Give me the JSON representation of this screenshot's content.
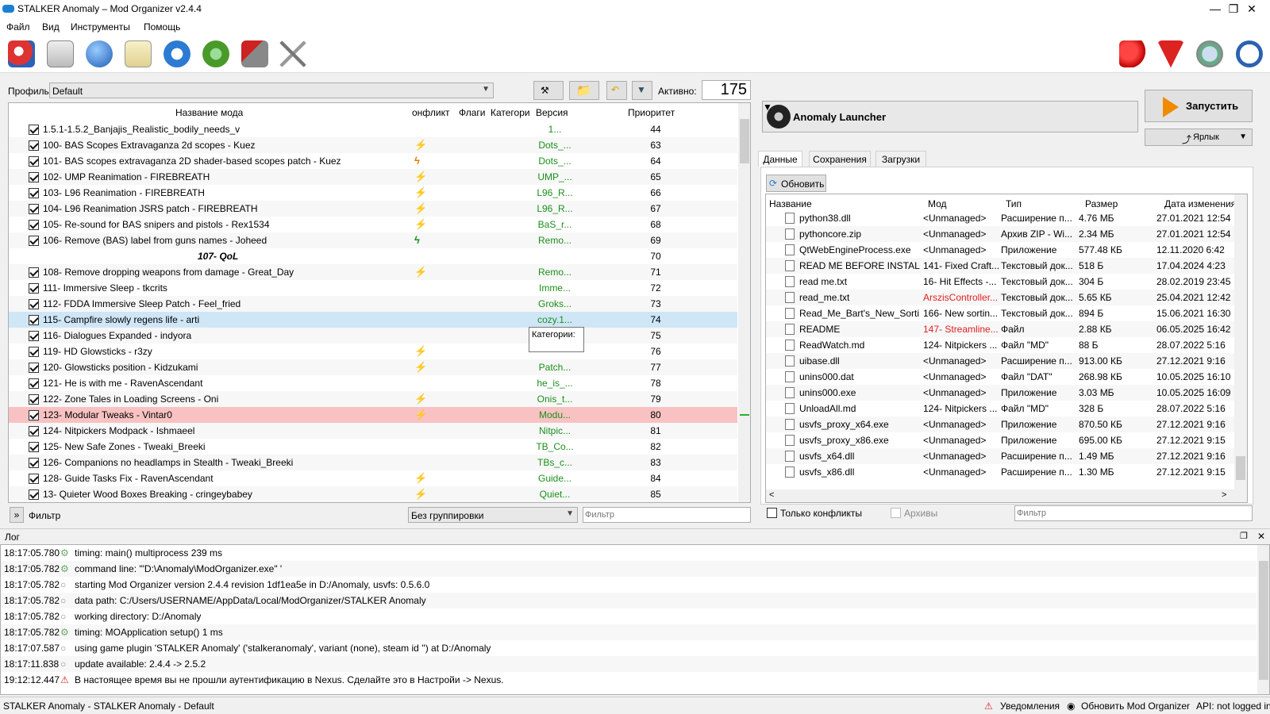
{
  "window": {
    "title": "STALKER Anomaly – Mod Organizer v2.4.4"
  },
  "menu": [
    "Файл",
    "Вид",
    "Инструменты",
    "Помощь"
  ],
  "profile": {
    "label": "Профиль",
    "value": "Default",
    "active_label": "Активно:",
    "active_count": "175"
  },
  "modlist": {
    "headers": {
      "name": "Название мода",
      "conflict": "онфликт",
      "flags": "Флаги",
      "category": "Категори",
      "version": "Версия",
      "priority": "Приоритет"
    },
    "tooltip": "Категории:",
    "rows": [
      {
        "name": "1.5.1-1.5.2_Banjajis_Realistic_bodily_needs_v",
        "conflict": "",
        "version": "1...",
        "priority": "44"
      },
      {
        "name": "100- BAS Scopes Extravaganza 2d scopes - Kuez",
        "conflict": "⚡",
        "version": "Dots_...",
        "priority": "63"
      },
      {
        "name": "101- BAS scopes extravaganza 2D shader-based scopes patch - Kuez",
        "conflict": "ϟ",
        "version": "Dots_...",
        "priority": "64"
      },
      {
        "name": "102- UMP Reanimation - FIREBREATH",
        "conflict": "⚡",
        "version": "UMP_...",
        "priority": "65"
      },
      {
        "name": "103- L96 Reanimation - FIREBREATH",
        "conflict": "⚡",
        "version": "L96_R...",
        "priority": "66"
      },
      {
        "name": "104- L96 Reanimation JSRS patch - FIREBREATH",
        "conflict": "⚡",
        "version": "L96_R...",
        "priority": "67"
      },
      {
        "name": "105- Re-sound for BAS snipers and pistols - Rex1534",
        "conflict": "⚡",
        "version": "BaS_r...",
        "priority": "68"
      },
      {
        "name": "106- Remove (BAS) label from guns names - Joheed",
        "conflict": "ϟ",
        "version": "Remo...",
        "priority": "69"
      },
      {
        "separator": "107- QoL",
        "priority": "70"
      },
      {
        "name": "108- Remove dropping weapons from damage - Great_Day",
        "conflict": "⚡",
        "version": "Remo...",
        "priority": "71"
      },
      {
        "name": "111- Immersive Sleep - tkcrits",
        "conflict": "",
        "version": "Imme...",
        "priority": "72"
      },
      {
        "name": "112- FDDA Immersive Sleep Patch - Feel_fried",
        "conflict": "",
        "version": "Groks...",
        "priority": "73"
      },
      {
        "name": "115- Campfire slowly regens life - arti",
        "conflict": "",
        "version": "cozy.1...",
        "priority": "74",
        "state": "sel"
      },
      {
        "name": "116- Dialogues Expanded - indyora",
        "conflict": "",
        "version": "",
        "priority": "75"
      },
      {
        "name": "119- HD Glowsticks - r3zy",
        "conflict": "⚡",
        "version": "",
        "priority": "76"
      },
      {
        "name": "120- Glowsticks position - Kidzukami",
        "conflict": "⚡",
        "version": "Patch...",
        "priority": "77"
      },
      {
        "name": "121- He is with me - RavenAscendant",
        "conflict": "",
        "version": "he_is_...",
        "priority": "78"
      },
      {
        "name": "122- Zone Tales in Loading Screens - Oni",
        "conflict": "⚡",
        "version": "Onis_t...",
        "priority": "79"
      },
      {
        "name": "123- Modular Tweaks - Vintar0",
        "conflict": "⚡",
        "version": "Modu...",
        "priority": "80",
        "state": "hl"
      },
      {
        "name": "124- Nitpickers Modpack - Ishmaeel",
        "conflict": "",
        "version": "Nitpic...",
        "priority": "81"
      },
      {
        "name": "125- New Safe Zones - Tweaki_Breeki",
        "conflict": "",
        "version": "TB_Co...",
        "priority": "82"
      },
      {
        "name": "126- Companions no headlamps in Stealth - Tweaki_Breeki",
        "conflict": "",
        "version": "TBs_c...",
        "priority": "83"
      },
      {
        "name": "128- Guide Tasks Fix - RavenAscendant",
        "conflict": "⚡",
        "version": "Guide...",
        "priority": "84"
      },
      {
        "name": "13- Quieter Wood Boxes Breaking - cringeybabey",
        "conflict": "⚡",
        "version": "Quiet...",
        "priority": "85"
      }
    ],
    "filter_label": "Фильтр",
    "grouping": "Без группировки",
    "filter_placeholder": "Фильтр"
  },
  "launcher": {
    "name": "Anomaly Launcher",
    "run_label": "Запустить",
    "shortcut_label": "Ярлык"
  },
  "tabs": [
    "Данные",
    "Сохранения",
    "Загрузки"
  ],
  "data": {
    "refresh_label": "Обновить",
    "headers": {
      "name": "Название",
      "mod": "Мод",
      "type": "Тип",
      "size": "Размер",
      "date": "Дата изменения"
    },
    "rows": [
      {
        "name": "python38.dll",
        "mod": "<Unmanaged>",
        "type": "Расширение п...",
        "size": "4.76 МБ",
        "date": "27.01.2021 12:54"
      },
      {
        "name": "pythoncore.zip",
        "mod": "<Unmanaged>",
        "type": "Архив ZIP - Wi...",
        "size": "2.34 МБ",
        "date": "27.01.2021 12:54"
      },
      {
        "name": "QtWebEngineProcess.exe",
        "mod": "<Unmanaged>",
        "type": "Приложение",
        "size": "577.48 КБ",
        "date": "12.11.2020 6:42"
      },
      {
        "name": "READ ME BEFORE INSTALL...",
        "mod": "141- Fixed Craft...",
        "type": "Текстовый док...",
        "size": "518 Б",
        "date": "17.04.2024 4:23"
      },
      {
        "name": "read me.txt",
        "mod": "16- Hit Effects -...",
        "type": "Текстовый док...",
        "size": "304 Б",
        "date": "28.02.2019 23:45"
      },
      {
        "name": "read_me.txt",
        "mod": "ArszisController...",
        "mod_red": true,
        "type": "Текстовый док...",
        "size": "5.65 КБ",
        "date": "25.04.2021 12:42"
      },
      {
        "name": "Read_Me_Bart's_New_Sorti...",
        "mod": "166- New sortin...",
        "type": "Текстовый док...",
        "size": "894 Б",
        "date": "15.06.2021 16:30"
      },
      {
        "name": "README",
        "mod": "147- Streamline...",
        "mod_red": true,
        "type": "Файл",
        "size": "2.88 КБ",
        "date": "06.05.2025 16:42"
      },
      {
        "name": "ReadWatch.md",
        "mod": "124- Nitpickers ...",
        "type": "Файл \"MD\"",
        "size": "88 Б",
        "date": "28.07.2022 5:16"
      },
      {
        "name": "uibase.dll",
        "mod": "<Unmanaged>",
        "type": "Расширение п...",
        "size": "913.00 КБ",
        "date": "27.12.2021 9:16"
      },
      {
        "name": "unins000.dat",
        "mod": "<Unmanaged>",
        "type": "Файл \"DAT\"",
        "size": "268.98 КБ",
        "date": "10.05.2025 16:10"
      },
      {
        "name": "unins000.exe",
        "mod": "<Unmanaged>",
        "type": "Приложение",
        "size": "3.03 МБ",
        "date": "10.05.2025 16:09"
      },
      {
        "name": "UnloadAll.md",
        "mod": "124- Nitpickers ...",
        "type": "Файл \"MD\"",
        "size": "328 Б",
        "date": "28.07.2022 5:16"
      },
      {
        "name": "usvfs_proxy_x64.exe",
        "mod": "<Unmanaged>",
        "type": "Приложение",
        "size": "870.50 КБ",
        "date": "27.12.2021 9:16"
      },
      {
        "name": "usvfs_proxy_x86.exe",
        "mod": "<Unmanaged>",
        "type": "Приложение",
        "size": "695.00 КБ",
        "date": "27.12.2021 9:15"
      },
      {
        "name": "usvfs_x64.dll",
        "mod": "<Unmanaged>",
        "type": "Расширение п...",
        "size": "1.49 МБ",
        "date": "27.12.2021 9:16"
      },
      {
        "name": "usvfs_x86.dll",
        "mod": "<Unmanaged>",
        "type": "Расширение п...",
        "size": "1.30 МБ",
        "date": "27.12.2021 9:15"
      }
    ],
    "conflicts_only": "Только конфликты",
    "archives": "Архивы",
    "filter_placeholder": "Фильтр"
  },
  "log": {
    "title": "Лог",
    "rows": [
      {
        "time": "18:17:05.780",
        "level": "debug",
        "text": "timing: main() multiprocess 239 ms"
      },
      {
        "time": "18:17:05.782",
        "level": "debug",
        "text": "command line: '\"D:\\Anomaly\\ModOrganizer.exe\" '"
      },
      {
        "time": "18:17:05.782",
        "level": "info",
        "text": "starting Mod Organizer version 2.4.4 revision 1df1ea5e in D:/Anomaly, usvfs: 0.5.6.0"
      },
      {
        "time": "18:17:05.782",
        "level": "info",
        "text": "data path: C:/Users/USERNAME/AppData/Local/ModOrganizer/STALKER Anomaly"
      },
      {
        "time": "18:17:05.782",
        "level": "info",
        "text": "working directory: D:/Anomaly"
      },
      {
        "time": "18:17:05.782",
        "level": "debug",
        "text": "timing: MOApplication setup() 1 ms"
      },
      {
        "time": "18:17:07.587",
        "level": "info",
        "text": "using game plugin 'STALKER Anomaly' ('stalkeranomaly', variant (none), steam id '') at D:/Anomaly"
      },
      {
        "time": "18:17:11.838",
        "level": "info",
        "text": "update available: 2.4.4 -> 2.5.2"
      },
      {
        "time": "19:12:12.447",
        "level": "warning",
        "text": "В настоящее время вы не прошли аутентификацию в Nexus. Сделайте это в Настройи -> Nexus."
      }
    ]
  },
  "status": {
    "left": "STALKER Anomaly - STALKER Anomaly - Default",
    "notifications": "Уведомления",
    "update": "Обновить Mod Organizer",
    "api": "API: not logged in"
  },
  "colors": {
    "conflict_green": "#1a8f1a",
    "conflict_orange": "#e07b00",
    "highlight_red": "#f8c2c2",
    "selection_blue": "#cfe6f7",
    "red_text": "#e02020"
  }
}
